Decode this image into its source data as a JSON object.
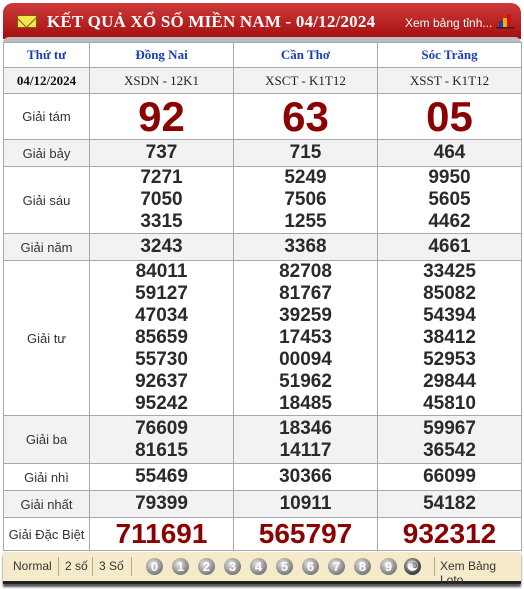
{
  "header": {
    "title": "KẾT QUẢ XỔ SỐ MIỀN NAM - 04/12/2024",
    "link": "Xem bảng tỉnh...",
    "icons": {
      "mail": "envelope-icon",
      "chart": "bar-chart-icon"
    }
  },
  "table": {
    "columns": [
      "Thứ tư",
      "Đồng Nai",
      "Cần Thơ",
      "Sóc Trăng"
    ],
    "date": "04/12/2024",
    "codes": [
      "XSDN - 12K1",
      "XSCT - K1T12",
      "XSST - K1T12"
    ],
    "prizes": [
      {
        "label": "Giải tám",
        "values": [
          [
            "92"
          ],
          [
            "63"
          ],
          [
            "05"
          ]
        ]
      },
      {
        "label": "Giải bảy",
        "values": [
          [
            "737"
          ],
          [
            "715"
          ],
          [
            "464"
          ]
        ]
      },
      {
        "label": "Giải sáu",
        "values": [
          [
            "7271",
            "7050",
            "3315"
          ],
          [
            "5249",
            "7506",
            "1255"
          ],
          [
            "9950",
            "5605",
            "4462"
          ]
        ]
      },
      {
        "label": "Giải năm",
        "values": [
          [
            "3243"
          ],
          [
            "3368"
          ],
          [
            "4661"
          ]
        ]
      },
      {
        "label": "Giải tư",
        "values": [
          [
            "84011",
            "59127",
            "47034",
            "85659",
            "55730",
            "92637",
            "95242"
          ],
          [
            "82708",
            "81767",
            "39259",
            "17453",
            "00094",
            "51962",
            "18485"
          ],
          [
            "33425",
            "85082",
            "54394",
            "38412",
            "52953",
            "29844",
            "45810"
          ]
        ]
      },
      {
        "label": "Giải ba",
        "values": [
          [
            "76609",
            "81615"
          ],
          [
            "18346",
            "14117"
          ],
          [
            "59967",
            "36542"
          ]
        ]
      },
      {
        "label": "Giải nhì",
        "values": [
          [
            "55469"
          ],
          [
            "30366"
          ],
          [
            "66099"
          ]
        ]
      },
      {
        "label": "Giải nhất",
        "values": [
          [
            "79399"
          ],
          [
            "10911"
          ],
          [
            "54182"
          ]
        ]
      },
      {
        "label": "Giải Đặc Biệt",
        "values": [
          [
            "711691"
          ],
          [
            "565797"
          ],
          [
            "932312"
          ]
        ]
      }
    ]
  },
  "footer": {
    "modes": [
      "Normal",
      "2 số",
      "3 Số"
    ],
    "digits": [
      "0",
      "1",
      "2",
      "3",
      "4",
      "5",
      "6",
      "7",
      "8",
      "9"
    ],
    "yin_yang": "☯",
    "loto_link": "Xem Bảng Loto"
  },
  "colors": {
    "header_red": "#b51a1a",
    "prize_red": "#8b0000",
    "header_blue": "#1a3fb5",
    "footer_bg": "#f5ebca"
  }
}
